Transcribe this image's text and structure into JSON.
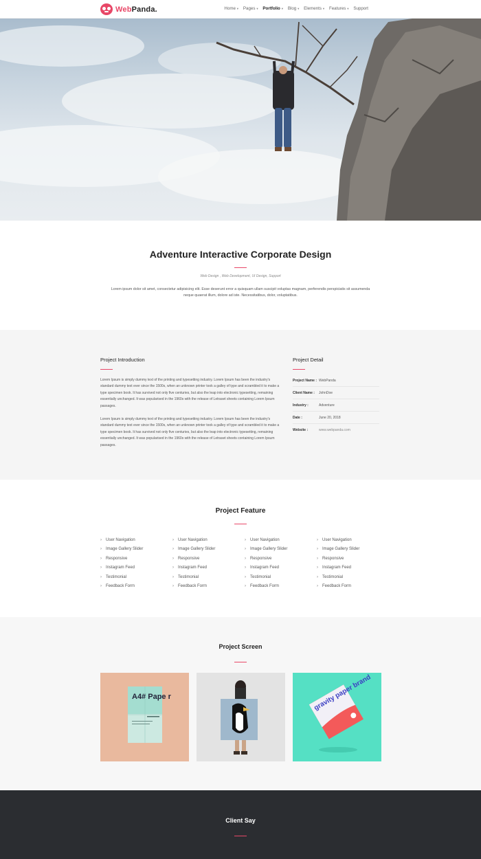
{
  "brand": {
    "name_part1": "Web",
    "name_part2": "Panda.",
    "accent_color": "#e84767"
  },
  "nav": {
    "items": [
      {
        "label": "Home",
        "has_dropdown": true,
        "active": false
      },
      {
        "label": "Pages",
        "has_dropdown": true,
        "active": false
      },
      {
        "label": "Portfolio",
        "has_dropdown": true,
        "active": true
      },
      {
        "label": "Blog",
        "has_dropdown": true,
        "active": false
      },
      {
        "label": "Elements",
        "has_dropdown": true,
        "active": false
      },
      {
        "label": "Features",
        "has_dropdown": true,
        "active": false
      },
      {
        "label": "Support",
        "has_dropdown": false,
        "active": false
      }
    ]
  },
  "hero": {
    "image": "man-hanging-from-branch-on-cliff"
  },
  "project": {
    "title": "Adventure Interactive Corporate Design",
    "tags": "Web Design , Web Development, UI Design, Support",
    "description": "Lorem ipsum dolor sit amet, consectetur adipisicing elit. Esse deserunt error a quisquam ullam suscipit voluptas magnam, perferendis perspiciatis sit assumenda neque quaerat illum, dolore ad iste. Necessitatibus, dolor, voluptatibus."
  },
  "introduction": {
    "title": "Project Introduction",
    "paragraphs": [
      "Lorem Ipsum is simply dummy text of the printing and typesetting industry. Lorem Ipsum has been the industry's standard dummy text ever since the 1500s, when an unknown printer took a galley of type and scrambled it to make a type specimen book. It has survived not only five centuries, but also the leap into electronic typesetting, remaining essentially unchanged. It was popularised in the 1960s with the release of Letraset sheets containing Lorem Ipsum passages.",
      "Lorem Ipsum is simply dummy text of the printing and typesetting industry. Lorem Ipsum has been the industry's standard dummy text ever since the 1500s, when an unknown printer took a galley of type and scrambled it to make a type specimen book. It has survived not only five centuries, but also the leap into electronic typesetting, remaining essentially unchanged. It was popularised in the 1960s with the release of Letraset sheets containing Lorem Ipsum passages."
    ]
  },
  "detail": {
    "title": "Project Detail",
    "rows": [
      {
        "key": "Project Name :",
        "value": "WebPanda"
      },
      {
        "key": "Client Name :",
        "value": "JohnDoe"
      },
      {
        "key": "Industry :",
        "value": "Adventure"
      },
      {
        "key": "Date :",
        "value": "June 20, 2018"
      },
      {
        "key": "Website :",
        "value": "www.webpanda.com"
      }
    ]
  },
  "features": {
    "title": "Project Feature",
    "columns": [
      [
        "User Navigation",
        "Image Gallery Slider",
        "Responsive",
        "Instagram Feed",
        "Testimonial",
        "Feedback Form"
      ],
      [
        "User Navigation",
        "Image Gallery Slider",
        "Responsive",
        "Instagram Feed",
        "Testimonial",
        "Feedback Form"
      ],
      [
        "User Navigation",
        "Image Gallery Slider",
        "Responsive",
        "Instagram Feed",
        "Testimonial",
        "Feedback Form"
      ],
      [
        "User Navigation",
        "Image Gallery Slider",
        "Responsive",
        "Instagram Feed",
        "Testimonial",
        "Feedback Form"
      ]
    ]
  },
  "screens": {
    "title": "Project Screen",
    "items": [
      {
        "name": "a4-paper-poster-mockup",
        "bg": "#e9b99e",
        "poster_text": "A4# Pape r"
      },
      {
        "name": "woman-holding-penguin-poster",
        "bg": "#e3e3e3"
      },
      {
        "name": "gravity-paper-brand-mockup",
        "bg": "#55e0c4",
        "poster_text": "gravity paper brand"
      }
    ]
  },
  "client": {
    "title": "Client Say"
  }
}
